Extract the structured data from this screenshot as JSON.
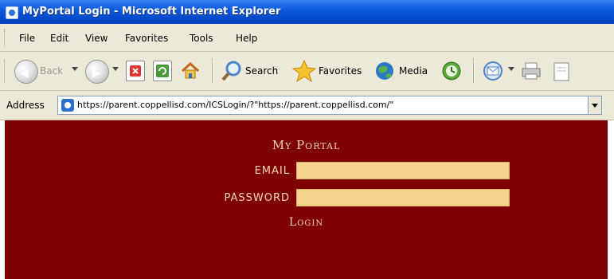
{
  "window": {
    "title": "MyPortal Login - Microsoft Internet Explorer"
  },
  "menubar": {
    "items": [
      "File",
      "Edit",
      "View",
      "Favorites",
      "Tools",
      "Help"
    ]
  },
  "toolbar": {
    "back_label": "Back",
    "search_label": "Search",
    "favorites_label": "Favorites",
    "media_label": "Media"
  },
  "address": {
    "label": "Address",
    "url": "https://parent.coppellisd.com/ICSLogin/?\"https://parent.coppellisd.com/\""
  },
  "portal": {
    "title": "My Portal",
    "email_label": "EMAIL",
    "password_label": "PASSWORD",
    "login_label": "Login",
    "background_color": "#7f0000",
    "input_color": "#f6d28f"
  }
}
